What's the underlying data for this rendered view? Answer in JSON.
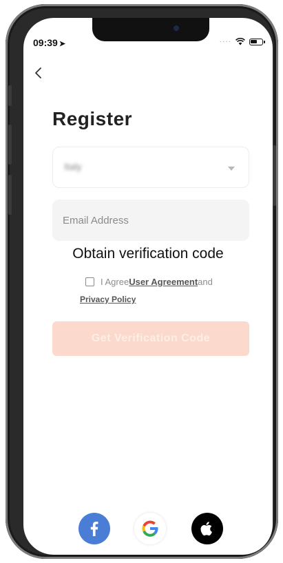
{
  "status_bar": {
    "time": "09:39",
    "location_glyph": "➤"
  },
  "page": {
    "title": "Register",
    "country_select": {
      "value": "Italy"
    },
    "email_field": {
      "placeholder": "Email Address",
      "value": ""
    },
    "obtain_text": "Obtain verification code",
    "agreement": {
      "prefix": "I Agree",
      "user_agreement_link": "User Agreement",
      "conjunction": "and",
      "privacy_policy_link": "Privacy Policy",
      "checked": false
    },
    "get_code_button": {
      "label": "Get Verification Code",
      "enabled": false
    }
  },
  "social_logins": [
    {
      "name": "facebook",
      "icon": "facebook-icon",
      "color": "#4a7dd6"
    },
    {
      "name": "google",
      "icon": "google-icon"
    },
    {
      "name": "apple",
      "icon": "apple-icon",
      "color": "#000000"
    }
  ],
  "colors": {
    "accent_disabled": "#fbd9cc",
    "brand_facebook": "#4a7dd6"
  }
}
